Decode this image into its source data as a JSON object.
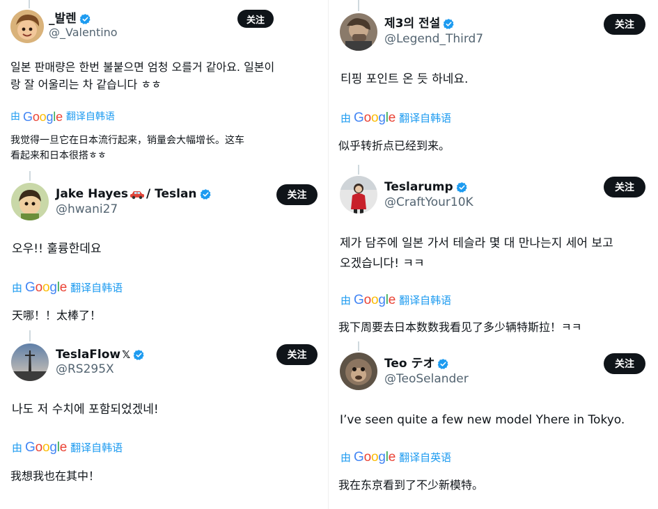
{
  "follow_label": "关注",
  "translate_by": "由",
  "google_logo": [
    "G",
    "o",
    "o",
    "g",
    "l",
    "e"
  ],
  "google_colors": [
    "#4285f4",
    "#ea4335",
    "#fbbc05",
    "#4285f4",
    "#34a853",
    "#ea4335"
  ],
  "verified_color": "#1d9bf0",
  "left_column": [
    {
      "name": "_발렌",
      "handle": "@_Valentino",
      "body": [
        "일본 판매량은 한번 불붙으면 엄청 오를거 같아요. 일본이",
        "랑 잘 어울리는 차 같습니다 ㅎㅎ"
      ],
      "translate_link": "翻译自韩语",
      "translation": [
        "我觉得一旦它在日本流行起来，销量会大幅增长。这车",
        "看起来和日本很搭ㅎㅎ"
      ]
    },
    {
      "name_prefix": "Jake Hayes",
      "name_suffix": "/ Teslan",
      "name_emoji": "car-emoji",
      "handle": "@hwani27",
      "body": [
        "오우!! 훌륭한데요"
      ],
      "translate_link": "翻译自韩语",
      "translation": [
        "天哪！！太棒了！"
      ]
    },
    {
      "name": "TeslaFlow",
      "name_badge": "𝕏",
      "handle": "@RS295X",
      "body": [
        "나도 저 수치에 포함되었겠네!"
      ],
      "translate_link": "翻译自韩语",
      "translation": [
        "我想我也在其中！"
      ]
    }
  ],
  "right_column": [
    {
      "name": "제3의 전설",
      "handle": "@Legend_Third7",
      "body": [
        "티핑 포인트 온 듯 하네요."
      ],
      "translate_link": "翻译自韩语",
      "translation": [
        "似乎转折点已经到来。"
      ]
    },
    {
      "name": "Teslarump",
      "handle": "@CraftYour10K",
      "body": [
        "제가 담주에 일본 가서 테슬라 몇 대 만나는지 세어 보고",
        "오겠습니다! ㅋㅋ"
      ],
      "translate_link": "翻译自韩语",
      "translation": [
        "我下周要去日本数数我看见了多少辆特斯拉！ㅋㅋ"
      ]
    },
    {
      "name": "Teo テオ",
      "handle": "@TeoSelander",
      "body": [
        "I’ve seen quite a few new model Yhere in Tokyo."
      ],
      "translate_link": "翻译自英语",
      "translation": [
        "我在东京看到了不少新模特。"
      ]
    }
  ]
}
